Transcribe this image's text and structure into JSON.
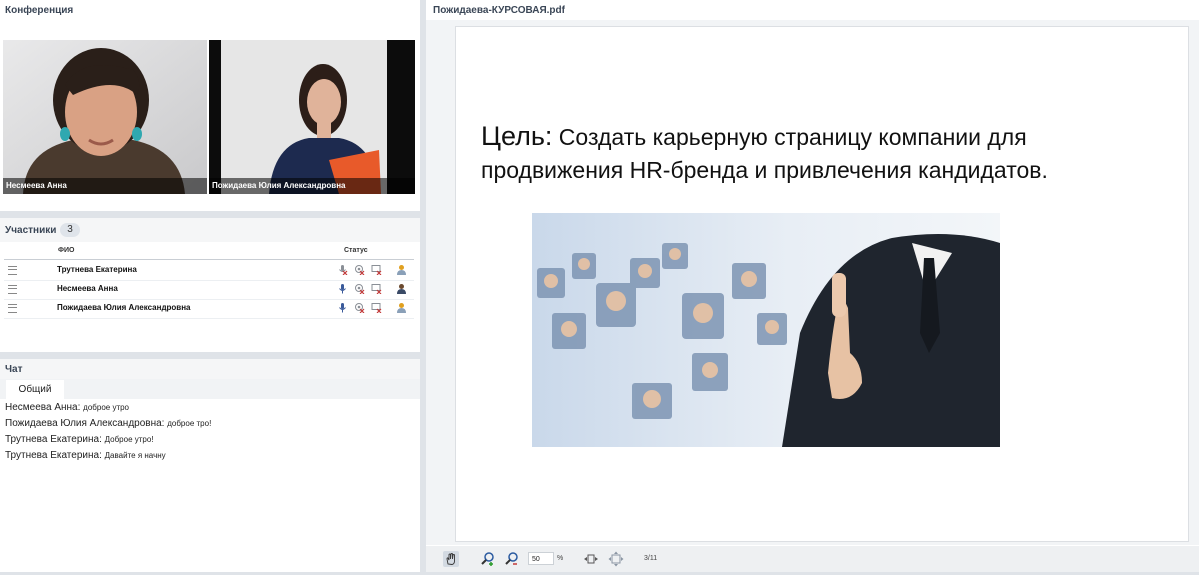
{
  "conference": {
    "title": "Конференция",
    "participants_video": [
      {
        "name": "Несмеева Анна"
      },
      {
        "name": "Пожидаева Юлия  Александровна"
      }
    ]
  },
  "participants": {
    "title": "Участники",
    "count": "3",
    "columns": {
      "fio": "ФИО",
      "status": "Статус"
    },
    "rows": [
      {
        "name": "Трутнева Екатерина"
      },
      {
        "name": "Несмеева Анна"
      },
      {
        "name": "Пожидаева Юлия  Александровна"
      }
    ]
  },
  "chat": {
    "title": "Чат",
    "tab": "Общий",
    "messages": [
      {
        "author": "Несмеева Анна:",
        "text": "доброе утро"
      },
      {
        "author": "Пожидаева Юлия  Александровна:",
        "text": "доброе тро!"
      },
      {
        "author": "Трутнева Екатерина:",
        "text": "Доброе утро!"
      },
      {
        "author": "Трутнева Екатерина:",
        "text": "Давайте я начну"
      }
    ]
  },
  "document": {
    "title": "Пожидаева-КУРСОВАЯ.pdf",
    "slide": {
      "goal_word": "Цель:",
      "text": " Создать карьерную страницу компании для продвижения HR-бренда и привлечения кандидатов."
    },
    "toolbar": {
      "zoom": "50",
      "zoom_unit": "%",
      "page": "3/11"
    }
  },
  "colors": {
    "mic_on": "#3a5a9a",
    "muted": "#c23a3a",
    "user_icon": "#e0a020"
  }
}
